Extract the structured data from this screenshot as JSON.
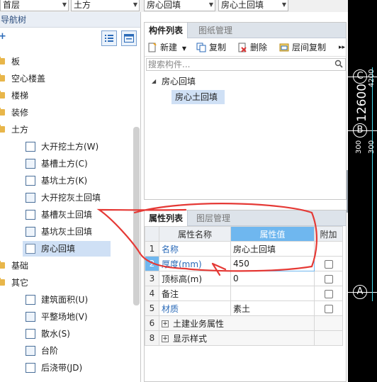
{
  "top_combos": {
    "floor": "首层",
    "category": "土方",
    "type": "房心回填",
    "component": "房心土回填"
  },
  "nav": {
    "title": "导航树",
    "tree": [
      {
        "label": "板",
        "kind": "folder"
      },
      {
        "label": "空心楼盖",
        "kind": "folder"
      },
      {
        "label": "楼梯",
        "kind": "folder"
      },
      {
        "label": "装修",
        "kind": "folder"
      },
      {
        "label": "土方",
        "kind": "folder"
      },
      {
        "label": "大开挖土方(W)",
        "kind": "item"
      },
      {
        "label": "基槽土方(C)",
        "kind": "item"
      },
      {
        "label": "基坑土方(K)",
        "kind": "item"
      },
      {
        "label": "大开挖灰土回填",
        "kind": "item"
      },
      {
        "label": "基槽灰土回填",
        "kind": "item"
      },
      {
        "label": "基坑灰土回填",
        "kind": "item"
      },
      {
        "label": "房心回填",
        "kind": "item",
        "selected": true
      },
      {
        "label": "基础",
        "kind": "folder"
      },
      {
        "label": "其它",
        "kind": "folder"
      },
      {
        "label": "建筑面积(U)",
        "kind": "item"
      },
      {
        "label": "平整场地(V)",
        "kind": "item"
      },
      {
        "label": "散水(S)",
        "kind": "item"
      },
      {
        "label": "台阶",
        "kind": "item"
      },
      {
        "label": "后浇带(JD)",
        "kind": "item"
      }
    ]
  },
  "component_panel": {
    "tabs": [
      "构件列表",
      "图纸管理"
    ],
    "toolbar": {
      "new": "新建",
      "copy": "复制",
      "delete": "删除",
      "floor_copy": "层间复制"
    },
    "search_placeholder": "搜索构件...",
    "tree": {
      "parent": "房心回填",
      "child": "房心土回填"
    }
  },
  "properties_panel": {
    "tabs": [
      "属性列表",
      "图层管理"
    ],
    "headers": {
      "name": "属性名称",
      "value": "属性值",
      "extra": "附加"
    },
    "rows": [
      {
        "num": "1",
        "name": "名称",
        "value": "房心土回填",
        "blue": true,
        "checkbox": false
      },
      {
        "num": "2",
        "name": "厚度(mm)",
        "value": "450",
        "blue": true,
        "checkbox": true,
        "selected": true
      },
      {
        "num": "3",
        "name": "顶标高(m)",
        "value": "0",
        "blue": false,
        "checkbox": true
      },
      {
        "num": "4",
        "name": "备注",
        "value": "",
        "blue": false,
        "checkbox": true
      },
      {
        "num": "5",
        "name": "材质",
        "value": "素土",
        "blue": true,
        "checkbox": true
      },
      {
        "num": "6",
        "name": "土建业务属性",
        "value": "",
        "group": true
      },
      {
        "num": "8",
        "name": "显示样式",
        "value": "",
        "group": true
      }
    ]
  },
  "canvas": {
    "axis_c": "C",
    "axis_b": "B",
    "axis_a": "A",
    "dim_total": "12600",
    "dim_4200": "4200",
    "dim_300a": "300",
    "dim_300b": "300"
  },
  "colors": {
    "accent": "#6fb7ef",
    "annotation": "#e53935",
    "label_blue": "#2a6ab8"
  }
}
